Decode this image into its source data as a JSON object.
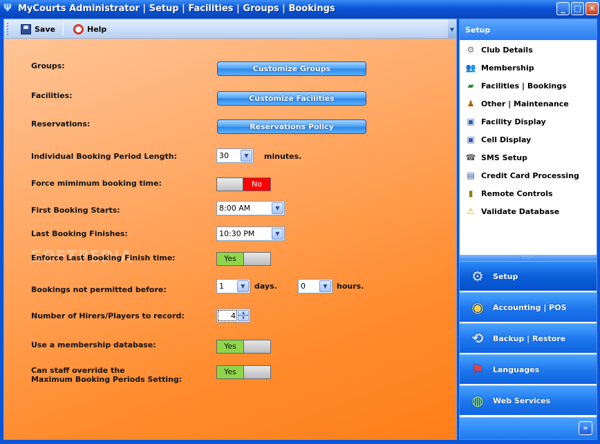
{
  "window": {
    "title": "MyCourts Administrator  |  Setup  |  Facilities  |  Groups  |  Bookings"
  },
  "toolbar": {
    "save_label": "Save",
    "help_label": "Help"
  },
  "form": {
    "groups_label": "Groups:",
    "groups_button": "Customize Groups",
    "facilities_label": "Facilities:",
    "facilities_button": "Customize Facilities",
    "reservations_label": "Reservations:",
    "reservations_button": "Reservations Policy",
    "booking_period_label": "Individual Booking Period Length:",
    "booking_period_value": "30",
    "booking_period_unit": "minutes.",
    "force_min_label": "Force mimimum booking time:",
    "force_min_value": "No",
    "first_booking_label": "First Booking Starts:",
    "first_booking_value": "8:00 AM",
    "last_booking_label": "Last Booking Finishes:",
    "last_booking_value": "10:30 PM",
    "enforce_last_label": "Enforce Last Booking Finish time:",
    "enforce_last_value": "Yes",
    "not_permitted_label": "Bookings not permitted before:",
    "not_permitted_days_value": "1",
    "not_permitted_days_unit": "days.",
    "not_permitted_hours_value": "0",
    "not_permitted_hours_unit": "hours.",
    "hirers_label": "Number of Hirers/Players to record:",
    "hirers_value": "4",
    "membership_db_label": "Use a membership database:",
    "membership_db_value": "Yes",
    "override_label_line1": "Can staff override the",
    "override_label_line2": "Maximum Booking Periods Setting:",
    "override_value": "Yes"
  },
  "watermark": "SOFTPEDIA",
  "sidebar": {
    "header": "Setup",
    "items": [
      {
        "label": "Club Details",
        "icon": "club-icon"
      },
      {
        "label": "Membership",
        "icon": "people-icon"
      },
      {
        "label": "Facilities | Bookings",
        "icon": "court-icon"
      },
      {
        "label": "Other | Maintenance",
        "icon": "worker-icon"
      },
      {
        "label": "Facility Display",
        "icon": "display-icon"
      },
      {
        "label": "Cell Display",
        "icon": "display-icon"
      },
      {
        "label": "SMS Setup",
        "icon": "phone-icon"
      },
      {
        "label": "Credit Card Processing",
        "icon": "card-icon"
      },
      {
        "label": "Remote Controls",
        "icon": "remote-icon"
      },
      {
        "label": "Validate Database",
        "icon": "warning-icon"
      }
    ],
    "splitter": "·····",
    "nav": [
      {
        "label": "Setup",
        "icon": "setup-icon"
      },
      {
        "label": "Accounting  |  POS",
        "icon": "coins-icon"
      },
      {
        "label": "Backup  |  Restore",
        "icon": "backup-icon"
      },
      {
        "label": "Languages",
        "icon": "flags-icon"
      },
      {
        "label": "Web Services",
        "icon": "globe-icon"
      }
    ]
  }
}
